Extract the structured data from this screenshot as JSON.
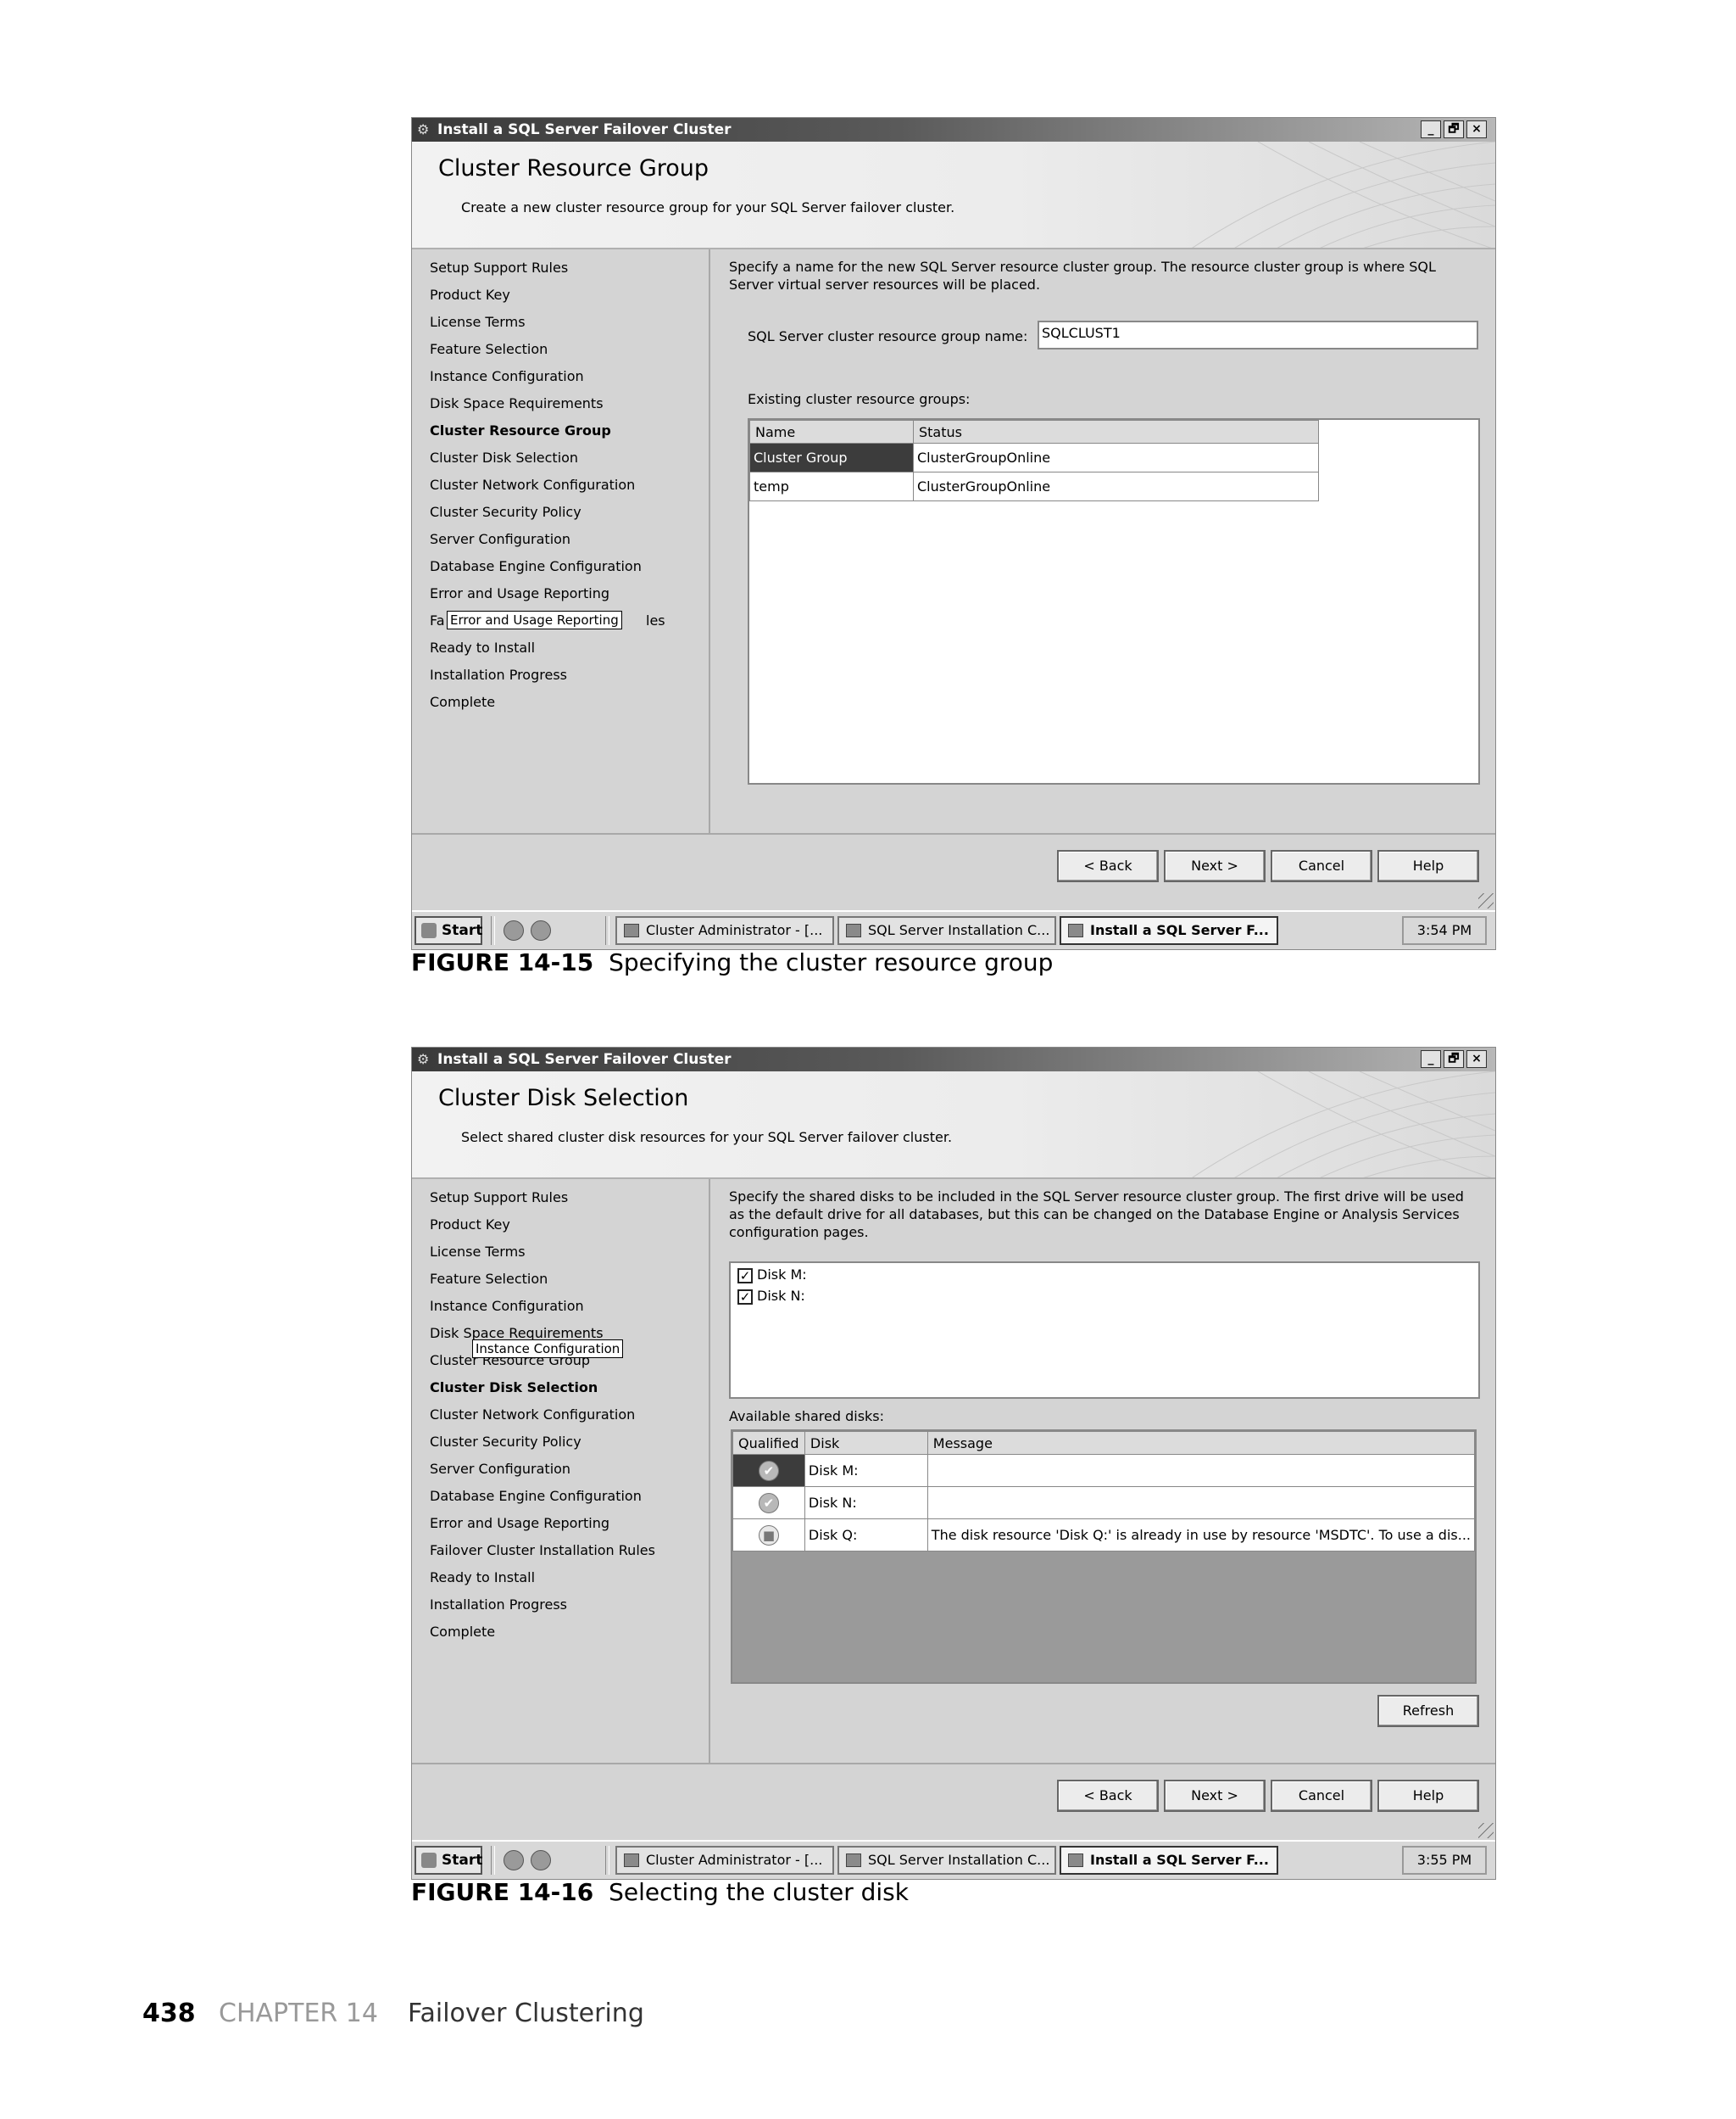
{
  "figures": [
    {
      "window": {
        "title": "Install a SQL Server Failover Cluster",
        "controls": [
          "_",
          "🗗",
          "×"
        ]
      },
      "header": {
        "title": "Cluster Resource Group",
        "subtitle": "Create a new cluster resource group for your SQL Server failover cluster."
      },
      "nav": {
        "items": [
          "Setup Support Rules",
          "Product Key",
          "License Terms",
          "Feature Selection",
          "Instance Configuration",
          "Disk Space Requirements",
          "Cluster Resource Group",
          "Cluster Disk Selection",
          "Cluster Network Configuration",
          "Cluster Security Policy",
          "Server Configuration",
          "Database Engine Configuration",
          "Error and Usage Reporting",
          "Fa",
          "Ready to Install",
          "Installation Progress",
          "Complete"
        ],
        "active_index": 6,
        "item14_tail": "les",
        "tooltip": "Error and Usage Reporting"
      },
      "content": {
        "description": "Specify a name for the new SQL Server resource cluster group. The resource cluster group is where SQL Server virtual server resources will be placed.",
        "name_label": "SQL Server cluster resource group name:",
        "name_value": "SQLCLUST1",
        "existing_label": "Existing cluster resource groups:",
        "columns": [
          "Name",
          "Status"
        ],
        "rows": [
          {
            "name": "Cluster Group",
            "status": "ClusterGroupOnline",
            "selected": true
          },
          {
            "name": "temp",
            "status": "ClusterGroupOnline",
            "selected": false
          }
        ]
      },
      "buttons": {
        "back": "< Back",
        "next": "Next >",
        "cancel": "Cancel",
        "help": "Help"
      },
      "taskbar": {
        "start": "Start",
        "tasks": [
          "Cluster Administrator - [...",
          "SQL Server Installation C...",
          "Install a SQL Server F..."
        ],
        "clock": "3:54 PM"
      },
      "caption": {
        "number": "FIGURE 14-15",
        "text": "Specifying the cluster resource group"
      }
    },
    {
      "window": {
        "title": "Install a SQL Server Failover Cluster",
        "controls": [
          "_",
          "🗗",
          "×"
        ]
      },
      "header": {
        "title": "Cluster Disk Selection",
        "subtitle": "Select shared cluster disk resources for your SQL Server failover cluster."
      },
      "nav": {
        "items": [
          "Setup Support Rules",
          "Product Key",
          "License Terms",
          "Feature Selection",
          "Instance Configuration",
          "Disk Space Requirements",
          "Cluster Resource Group",
          "Cluster Disk Selection",
          "Cluster Network Configuration",
          "Cluster Security Policy",
          "Server Configuration",
          "Database Engine Configuration",
          "Error and Usage Reporting",
          "Failover Cluster Installation Rules",
          "Ready to Install",
          "Installation Progress",
          "Complete"
        ],
        "active_index": 7,
        "tooltip": "Instance Configuration"
      },
      "content": {
        "description": "Specify the shared disks to be included in the SQL Server resource cluster group. The first drive will be used as the default drive for all databases, but this can be changed on the Database Engine or Analysis Services configuration pages.",
        "checked_disks": [
          "Disk M:",
          "Disk N:"
        ],
        "available_label": "Available shared disks:",
        "columns": [
          "Qualified",
          "Disk",
          "Message"
        ],
        "rows": [
          {
            "qualified": "✔",
            "disk": "Disk M:",
            "message": ""
          },
          {
            "qualified": "✔",
            "disk": "Disk N:",
            "message": ""
          },
          {
            "qualified": "■",
            "disk": "Disk Q:",
            "message": "The disk resource 'Disk Q:' is already in use by resource 'MSDTC'. To use a dis..."
          }
        ],
        "refresh": "Refresh"
      },
      "buttons": {
        "back": "< Back",
        "next": "Next >",
        "cancel": "Cancel",
        "help": "Help"
      },
      "taskbar": {
        "start": "Start",
        "tasks": [
          "Cluster Administrator - [...",
          "SQL Server Installation C...",
          "Install a SQL Server F..."
        ],
        "clock": "3:55 PM"
      },
      "caption": {
        "number": "FIGURE 14-16",
        "text": "Selecting the cluster disk"
      }
    }
  ],
  "page_footer": {
    "page_number": "438",
    "chapter": "CHAPTER 14",
    "title": "Failover Clustering"
  },
  "colors": {
    "selection": "#3c3c3c",
    "window_bg": "#d4d4d4",
    "empty_grid": "#9a9a9a"
  }
}
